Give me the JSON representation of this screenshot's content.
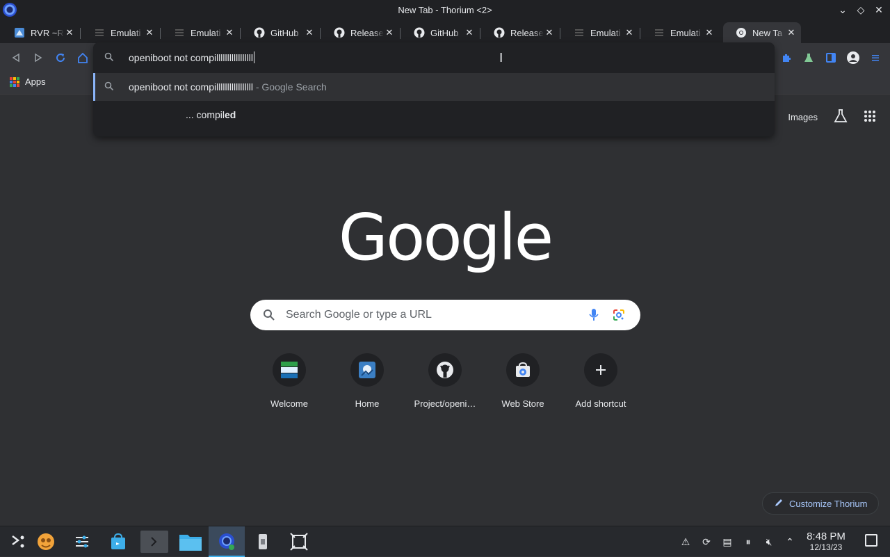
{
  "window": {
    "title": "New Tab - Thorium <2>"
  },
  "tabs": [
    {
      "label": "RVR ~Ri",
      "icon": "rvr-favicon-icon"
    },
    {
      "label": "Emulati",
      "icon": "emulation-favicon-icon"
    },
    {
      "label": "Emulati",
      "icon": "emulation-favicon-icon"
    },
    {
      "label": "GitHub",
      "icon": "github-icon"
    },
    {
      "label": "Release",
      "icon": "github-icon"
    },
    {
      "label": "GitHub",
      "icon": "github-icon"
    },
    {
      "label": "Release",
      "icon": "github-icon"
    },
    {
      "label": "Emulati",
      "icon": "emulation-favicon-icon"
    },
    {
      "label": "Emulati",
      "icon": "emulation-favicon-icon"
    },
    {
      "label": "New Ta",
      "icon": "chrome-icon",
      "active": true
    }
  ],
  "omnibox": {
    "value": "openiboot not compilllllllllllllllll",
    "suggestions": [
      {
        "text": "openiboot not compilllllllllllllllll",
        "suffix": " - Google Search"
      },
      {
        "prefix": "... compil",
        "bold": "ed"
      }
    ]
  },
  "bookmarks": {
    "apps_label": "Apps"
  },
  "ntp": {
    "logo": "Google",
    "images_link": "Images",
    "search_placeholder": "Search Google or type a URL",
    "shortcuts": [
      {
        "label": "Welcome",
        "icon": "welcome-icon"
      },
      {
        "label": "Home",
        "icon": "home-site-icon"
      },
      {
        "label": "Project/openi…",
        "icon": "github-icon"
      },
      {
        "label": "Web Store",
        "icon": "web-store-icon"
      },
      {
        "label": "Add shortcut",
        "icon": "plus-icon"
      }
    ],
    "customize_label": "Customize Thorium"
  },
  "taskbar": {
    "time": "8:48 PM",
    "date": "12/13/23"
  },
  "colors": {
    "accent": "#8ab4f8",
    "page_bg": "#2f3033",
    "omnibox_bg": "#202124",
    "taskbar_active": "#3daee9"
  }
}
